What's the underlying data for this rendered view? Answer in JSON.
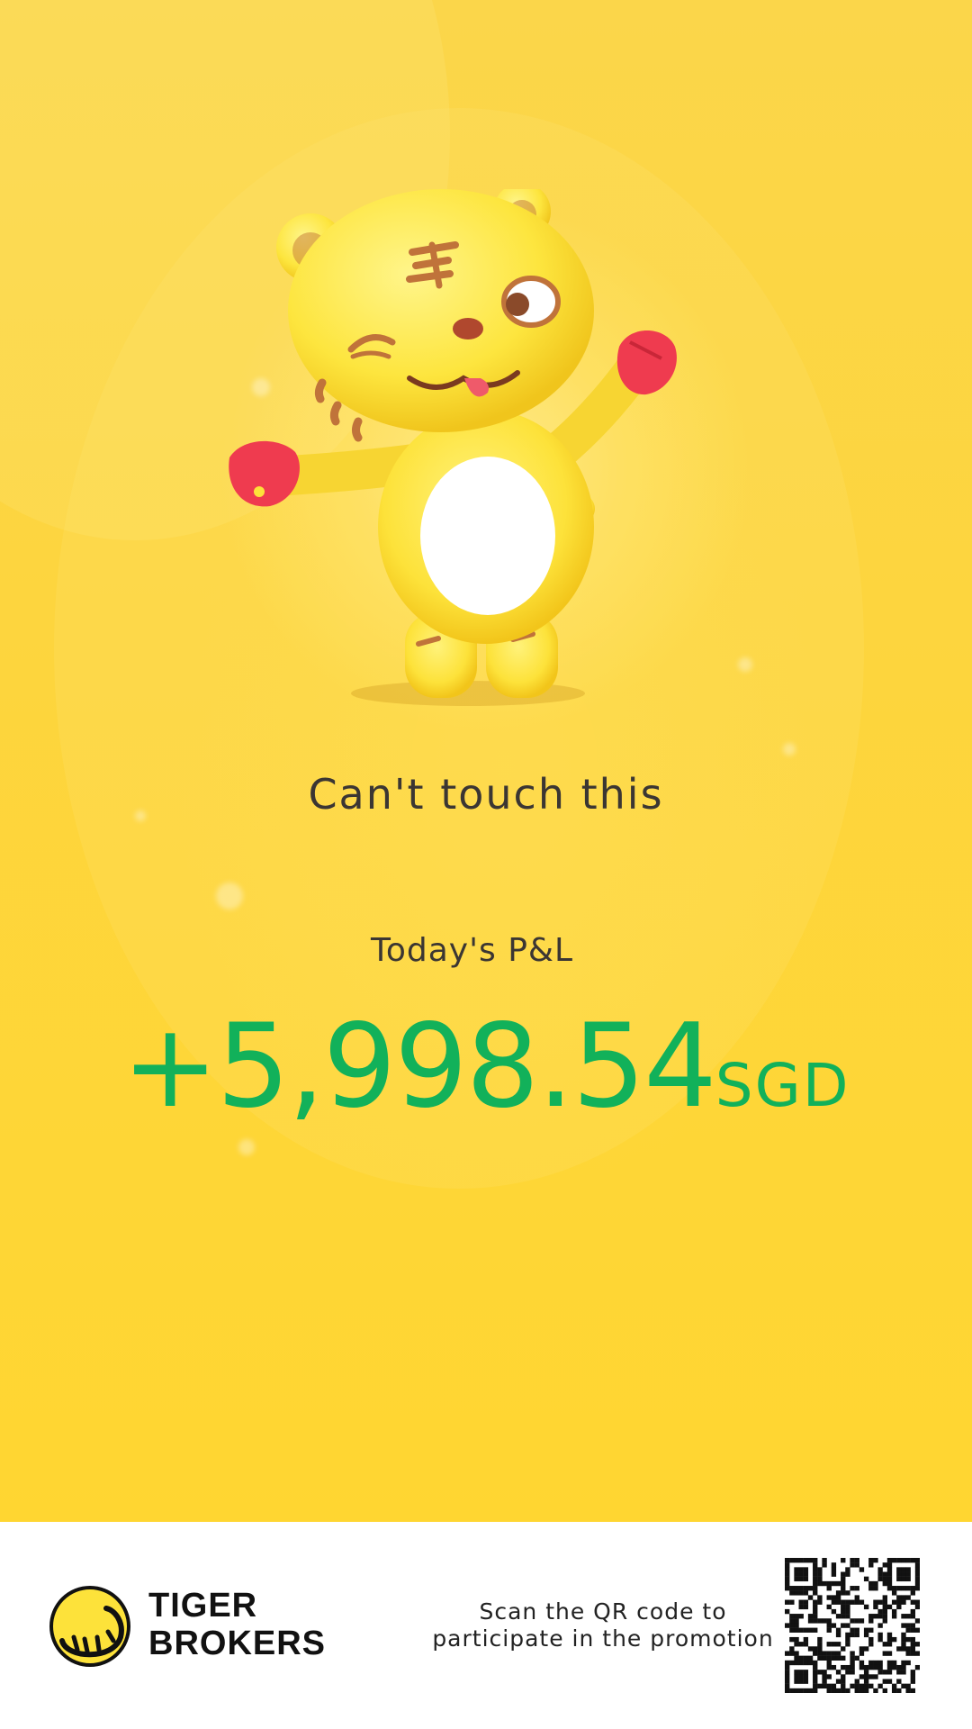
{
  "hero": {
    "tagline": "Can't touch this",
    "pnl_label": "Today's P&L",
    "pnl_value": "+5,998.54",
    "pnl_currency": "SGD"
  },
  "colors": {
    "background": "#fdd53e",
    "profit": "#12b15a",
    "text": "#3b3633",
    "mascot_body": "#fde23a",
    "mascot_accent": "#ef3b4f"
  },
  "mascot": {
    "icon": "tiger-mascot-icon"
  },
  "footer": {
    "brand_line1": "TIGER",
    "brand_line2": "BROKERS",
    "scan_line1": "Scan the QR code to",
    "scan_line2": "participate in the promotion",
    "logo_icon": "tiger-brokers-logo-icon",
    "qr_icon": "qr-code-icon"
  }
}
